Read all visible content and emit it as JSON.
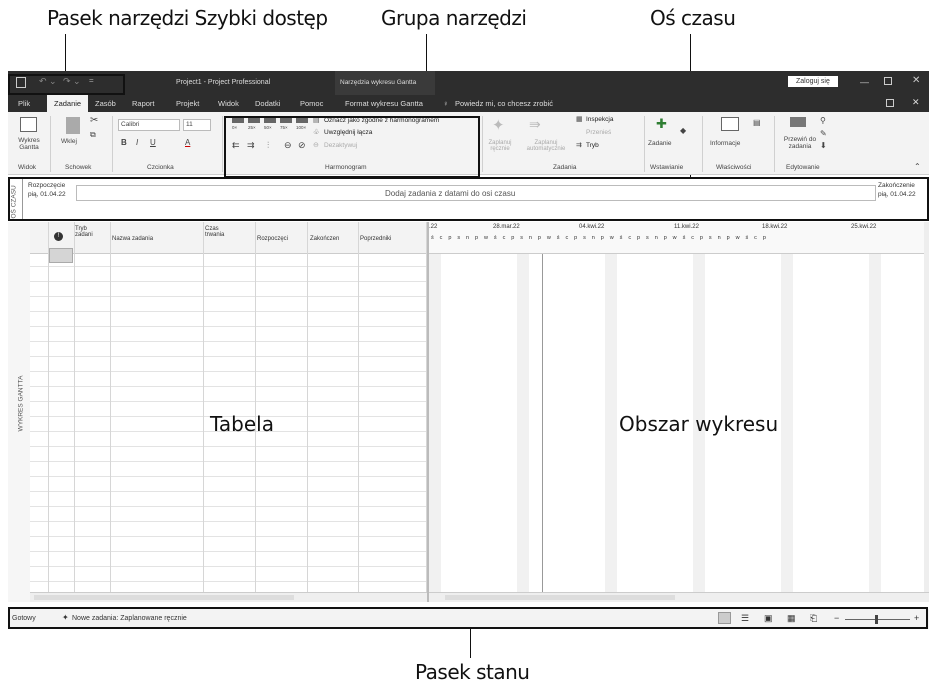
{
  "callouts": {
    "qat": "Pasek narzędzi Szybki dostęp",
    "tool_group": "Grupa narzędzi",
    "timeline": "Oś czasu",
    "status_bar": "Pasek stanu",
    "table": "Tabela",
    "chart_area": "Obszar wykresu"
  },
  "titlebar": {
    "title": "Project1  -  Project Professional",
    "context_tab": "Narzędzia wykresu Gantta",
    "sign_in": "Zaloguj się"
  },
  "menu": {
    "file": "Plik",
    "task": "Zadanie",
    "resource": "Zasób",
    "report": "Raport",
    "project": "Projekt",
    "view": "Widok",
    "addins": "Dodatki",
    "help": "Pomoc",
    "format": "Format wykresu Gantta",
    "tellme": "Powiedz mi, co chcesz zrobić"
  },
  "ribbon": {
    "gantt_btn": "Wykres Gantta",
    "view_grp": "Widok",
    "paste_btn": "Wklej",
    "clipboard_grp": "Schowek",
    "font_name": "Calibri",
    "font_size": "11",
    "font_grp": "Czcionka",
    "pct": [
      "0×",
      "25×",
      "50×",
      "75×",
      "100×"
    ],
    "mark_on_track": "Oznacz jako zgodne z harmonogramem",
    "respect_links": "Uwzględnij łącza",
    "inactivate": "Dezaktywuj",
    "schedule_grp": "Harmonogram",
    "manual": "Zaplanuj ręcznie",
    "auto": "Zaplanuj automatycznie",
    "inspect": "Inspekcja",
    "move": "Przenieś",
    "mode": "Tryb",
    "tasks_grp": "Zadania",
    "task_btn": "Zadanie",
    "insert_grp": "Wstawianie",
    "info_btn": "Informacje",
    "props_grp": "Właściwości",
    "scroll_to": "Przewiń do zadania",
    "edit_grp": "Edytowanie"
  },
  "timeline": {
    "side_label": "OŚ CZASU",
    "start_label": "Rozpoczęcie",
    "start_date": "pią, 01.04.22",
    "end_label": "Zakończenie",
    "end_date": "pią, 01.04.22",
    "placeholder": "Dodaj zadania z datami do osi czasu"
  },
  "table": {
    "side_label": "WYKRES GANTTA",
    "columns": [
      "Tryb zadani",
      "Nazwa zadania",
      "Czas trwania",
      "Rozpoczęci",
      "Zakończen",
      "Poprzedniki"
    ]
  },
  "chart": {
    "weeks": [
      ".22",
      "28.mar.22",
      "04.kwi.22",
      "11.kwi.22",
      "18.kwi.22",
      "25.kwi.22"
    ],
    "days": "ś c p s n p w ś c p s n p w ś c p s n p w ś c p s n p w ś c p s n p w ś c p"
  },
  "status": {
    "ready": "Gotowy",
    "new_tasks": "Nowe zadania: Zaplanowane ręcznie"
  }
}
